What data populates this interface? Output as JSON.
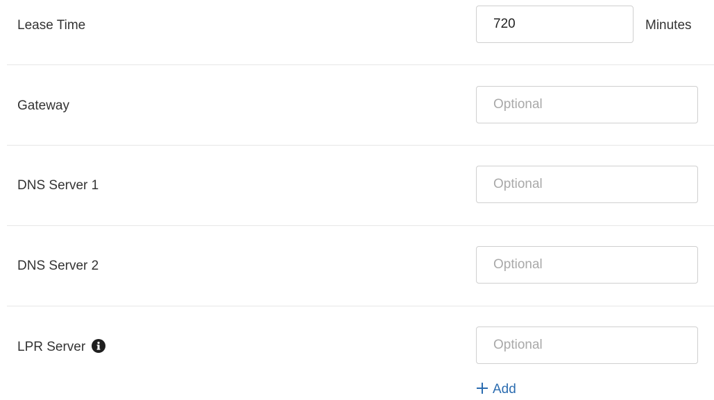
{
  "lease_time": {
    "label": "Lease Time",
    "value": "720",
    "unit": "Minutes"
  },
  "gateway": {
    "label": "Gateway",
    "value": "",
    "placeholder": "Optional"
  },
  "dns_server_1": {
    "label": "DNS Server 1",
    "value": "",
    "placeholder": "Optional"
  },
  "dns_server_2": {
    "label": "DNS Server 2",
    "value": "",
    "placeholder": "Optional"
  },
  "lpr_server": {
    "label": "LPR Server",
    "info_icon": "info-circle-icon",
    "value": "",
    "placeholder": "Optional"
  },
  "add_link": {
    "icon": "plus-icon",
    "label": "Add"
  },
  "colors": {
    "link": "#2b6cb0",
    "divider": "#e6e6e6",
    "input_border": "#cfcfcf",
    "placeholder": "#a9a9a9",
    "text": "#333333"
  }
}
